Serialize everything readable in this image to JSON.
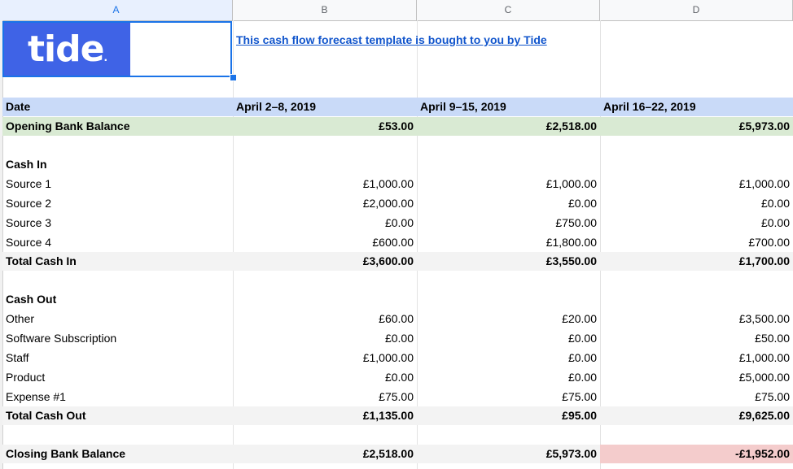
{
  "columns": [
    "A",
    "B",
    "C",
    "D"
  ],
  "logo": {
    "text": "tide"
  },
  "banner": {
    "text": "This cash flow forecast template is bought to you by Tide"
  },
  "header": {
    "label": "Date",
    "periods": [
      "April 2–8, 2019",
      "April 9–15, 2019",
      "April 16–22, 2019"
    ]
  },
  "opening": {
    "label": "Opening Bank Balance",
    "values": [
      "£53.00",
      "£2,518.00",
      "£5,973.00"
    ]
  },
  "cash_in": {
    "label": "Cash In",
    "rows": [
      {
        "label": "Source 1",
        "values": [
          "£1,000.00",
          "£1,000.00",
          "£1,000.00"
        ]
      },
      {
        "label": "Source 2",
        "values": [
          "£2,000.00",
          "£0.00",
          "£0.00"
        ]
      },
      {
        "label": "Source 3",
        "values": [
          "£0.00",
          "£750.00",
          "£0.00"
        ]
      },
      {
        "label": "Source 4",
        "values": [
          "£600.00",
          "£1,800.00",
          "£700.00"
        ]
      }
    ],
    "total": {
      "label": "Total Cash In",
      "values": [
        "£3,600.00",
        "£3,550.00",
        "£1,700.00"
      ]
    }
  },
  "cash_out": {
    "label": "Cash Out",
    "rows": [
      {
        "label": "Other",
        "values": [
          "£60.00",
          "£20.00",
          "£3,500.00"
        ]
      },
      {
        "label": "Software Subscription",
        "values": [
          "£0.00",
          "£0.00",
          "£50.00"
        ]
      },
      {
        "label": "Staff",
        "values": [
          "£1,000.00",
          "£0.00",
          "£1,000.00"
        ]
      },
      {
        "label": "Product",
        "values": [
          "£0.00",
          "£0.00",
          "£5,000.00"
        ]
      },
      {
        "label": "Expense #1",
        "values": [
          "£75.00",
          "£75.00",
          "£75.00"
        ]
      }
    ],
    "total": {
      "label": "Total Cash Out",
      "values": [
        "£1,135.00",
        "£95.00",
        "£9,625.00"
      ]
    }
  },
  "closing": {
    "label": "Closing Bank Balance",
    "values": [
      "£2,518.00",
      "£5,973.00",
      "-£1,952.00"
    ]
  },
  "colors": {
    "header_fill": "#c9daf8",
    "opening_fill": "#d9ead3",
    "total_fill": "#f3f3f3",
    "negative_fill": "#f4cccc",
    "brand": "#3f63e6",
    "link": "#1155cc"
  }
}
